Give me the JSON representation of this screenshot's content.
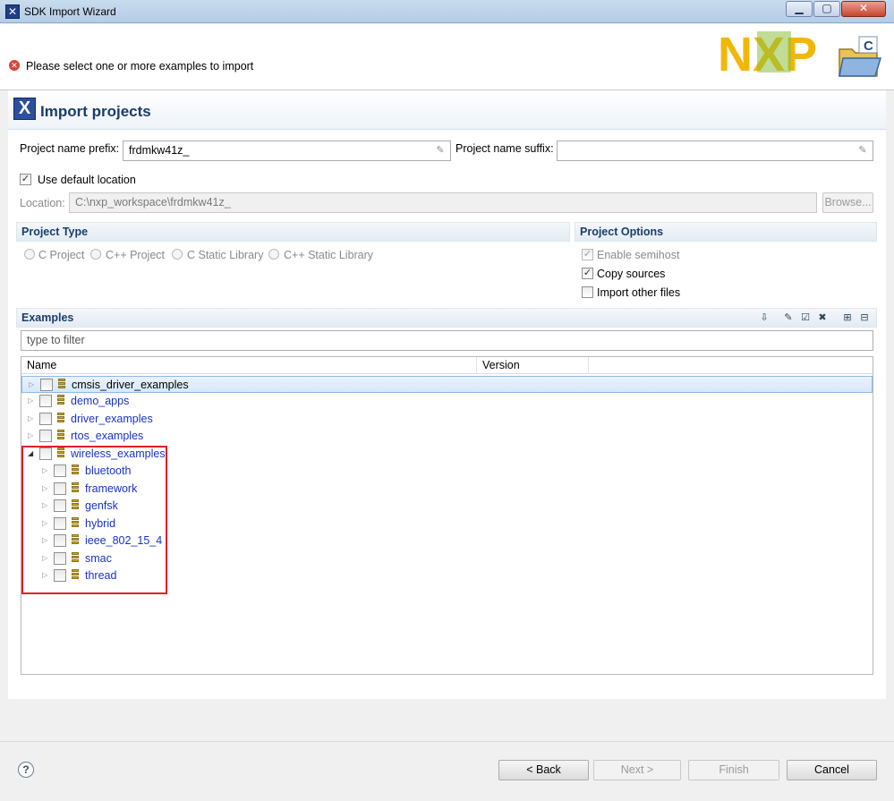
{
  "window": {
    "title": "SDK Import Wizard"
  },
  "banner": {
    "message": "Please select one or more examples to import",
    "logo_text": "NXP",
    "folder_letter": "C"
  },
  "page": {
    "heading": "Import projects"
  },
  "prefix": {
    "label": "Project name prefix:",
    "value": "frdmkw41z_"
  },
  "suffix": {
    "label": "Project name suffix:",
    "value": ""
  },
  "location": {
    "use_default_label": "Use default location",
    "use_default_checked": true,
    "label": "Location:",
    "value": "C:\\nxp_workspace\\frdmkw41z_",
    "browse_label": "Browse..."
  },
  "project_type": {
    "title": "Project Type",
    "options": [
      "C Project",
      "C++ Project",
      "C Static Library",
      "C++ Static Library"
    ]
  },
  "project_options": {
    "title": "Project Options",
    "items": [
      {
        "label": "Enable semihost",
        "checked": true,
        "enabled": false
      },
      {
        "label": "Copy sources",
        "checked": true,
        "enabled": true
      },
      {
        "label": "Import other files",
        "checked": false,
        "enabled": true
      }
    ]
  },
  "examples": {
    "title": "Examples",
    "filter_placeholder": "type to filter",
    "columns": [
      "Name",
      "Version"
    ],
    "rows": [
      {
        "label": "cmsis_driver_examples",
        "level": 0,
        "expanded": false,
        "selected": true
      },
      {
        "label": "demo_apps",
        "level": 0,
        "expanded": false
      },
      {
        "label": "driver_examples",
        "level": 0,
        "expanded": false
      },
      {
        "label": "rtos_examples",
        "level": 0,
        "expanded": false
      },
      {
        "label": "wireless_examples",
        "level": 0,
        "expanded": true
      },
      {
        "label": "bluetooth",
        "level": 1,
        "expanded": false
      },
      {
        "label": "framework",
        "level": 1,
        "expanded": false
      },
      {
        "label": "genfsk",
        "level": 1,
        "expanded": false
      },
      {
        "label": "hybrid",
        "level": 1,
        "expanded": false
      },
      {
        "label": "ieee_802_15_4",
        "level": 1,
        "expanded": false
      },
      {
        "label": "smac",
        "level": 1,
        "expanded": false
      },
      {
        "label": "thread",
        "level": 1,
        "expanded": false
      }
    ]
  },
  "buttons": {
    "back": "< Back",
    "next": "Next >",
    "finish": "Finish",
    "cancel": "Cancel"
  },
  "colors": {
    "accent": "#1a3d6b",
    "link": "#1a33c6",
    "highlight_box": "#e0202a"
  }
}
